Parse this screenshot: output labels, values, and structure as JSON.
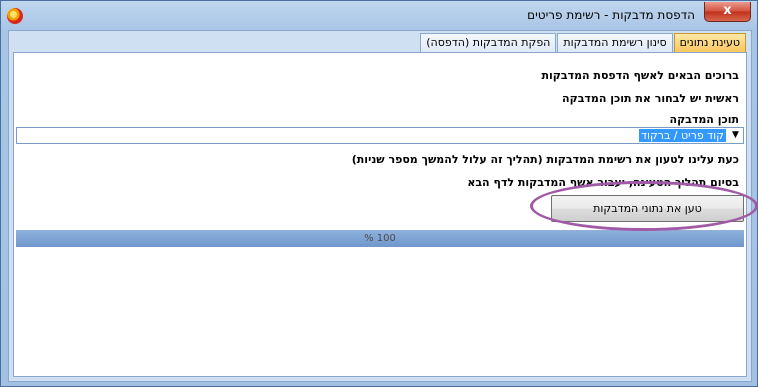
{
  "window": {
    "title": "הדפסת מדבקות - רשימת פריטים",
    "close_label": "x"
  },
  "tabs": [
    {
      "label": "טעינת נתונים",
      "active": true
    },
    {
      "label": "סינון רשימת המדבקות",
      "active": false
    },
    {
      "label": "הפקת המדבקות (הדפסה)",
      "active": false
    }
  ],
  "content": {
    "welcome": "ברוכים הבאים לאשף הדפסת המדבקות",
    "choose_first": "ראשית יש לבחור את תוכן המדבקה",
    "content_label": "תוכן המדבקה",
    "content_value": "קוד פריט / ברקוד",
    "load_instruction": "כעת עלינו לטעון את רשימת המדבקות (תהליך זה עלול להמשך מספר שניות)",
    "after_load": "בסיום תהליך הטעינה, יעבור אשף המדבקות לדף הבא",
    "load_button": "טען את נתוני המדבקות"
  },
  "progress": {
    "percent": 100,
    "label": "100 %"
  },
  "colors": {
    "active_tab": "#f7c55d",
    "highlight_oval": "#a05aa6",
    "selection": "#3399ff"
  }
}
